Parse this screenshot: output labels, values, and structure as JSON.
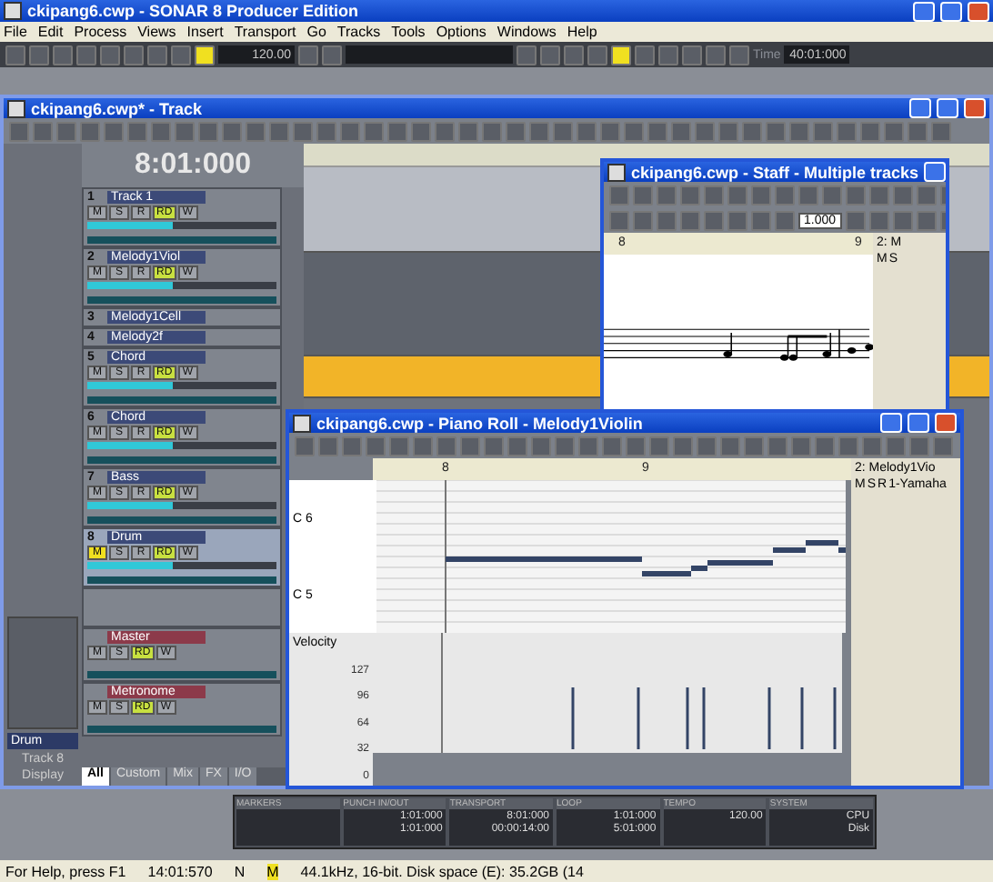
{
  "app": {
    "title": "ckipang6.cwp - SONAR 8 Producer Edition",
    "menu": [
      "File",
      "Edit",
      "Process",
      "Views",
      "Insert",
      "Transport",
      "Go",
      "Tracks",
      "Tools",
      "Options",
      "Windows",
      "Help"
    ],
    "toolbar": {
      "tempo": "120.00",
      "time_label": "Time",
      "time": "40:01:000"
    }
  },
  "track_view": {
    "title": "ckipang6.cwp* - Track",
    "now_time": "8:01:000",
    "inspector": {
      "track_name": "Drum",
      "track_number": "Track 8",
      "display": "Display"
    },
    "tracks": [
      {
        "number": "1",
        "name": "Track 1",
        "kind": "full",
        "selected": false,
        "buttons": [
          {
            "label": "M",
            "on": false
          },
          {
            "label": "S",
            "on": false
          },
          {
            "label": "R",
            "on": false
          },
          {
            "label": "RD",
            "on": true
          },
          {
            "label": "W",
            "on": false
          }
        ]
      },
      {
        "number": "2",
        "name": "Melody1Viol",
        "kind": "full",
        "selected": false,
        "buttons": [
          {
            "label": "M",
            "on": false
          },
          {
            "label": "S",
            "on": false
          },
          {
            "label": "R",
            "on": false
          },
          {
            "label": "RD",
            "on": true
          },
          {
            "label": "W",
            "on": false
          }
        ]
      },
      {
        "number": "3",
        "name": "Melody1Cell",
        "kind": "compact",
        "selected": false
      },
      {
        "number": "4",
        "name": "Melody2f",
        "kind": "compact",
        "selected": false
      },
      {
        "number": "5",
        "name": "Chord",
        "kind": "full",
        "selected": false,
        "buttons": [
          {
            "label": "M",
            "on": false
          },
          {
            "label": "S",
            "on": false
          },
          {
            "label": "R",
            "on": false
          },
          {
            "label": "RD",
            "on": true
          },
          {
            "label": "W",
            "on": false
          }
        ]
      },
      {
        "number": "6",
        "name": "Chord",
        "kind": "full",
        "selected": false,
        "buttons": [
          {
            "label": "M",
            "on": false
          },
          {
            "label": "S",
            "on": false
          },
          {
            "label": "R",
            "on": false
          },
          {
            "label": "RD",
            "on": true
          },
          {
            "label": "W",
            "on": false
          }
        ]
      },
      {
        "number": "7",
        "name": "Bass",
        "kind": "full",
        "selected": false,
        "buttons": [
          {
            "label": "M",
            "on": false
          },
          {
            "label": "S",
            "on": false
          },
          {
            "label": "R",
            "on": false
          },
          {
            "label": "RD",
            "on": true
          },
          {
            "label": "W",
            "on": false
          }
        ]
      },
      {
        "number": "8",
        "name": "Drum",
        "kind": "full",
        "selected": true,
        "buttons": [
          {
            "label": "M",
            "on": true
          },
          {
            "label": "S",
            "on": false
          },
          {
            "label": "R",
            "on": false
          },
          {
            "label": "RD",
            "on": true
          },
          {
            "label": "W",
            "on": false
          }
        ]
      }
    ],
    "buses": [
      {
        "name": "Master",
        "buttons": [
          {
            "label": "M",
            "on": false
          },
          {
            "label": "S",
            "on": false
          },
          {
            "label": "RD",
            "on": true
          },
          {
            "label": "W",
            "on": false
          }
        ]
      },
      {
        "name": "Metronome",
        "buttons": [
          {
            "label": "M",
            "on": false
          },
          {
            "label": "S",
            "on": false
          },
          {
            "label": "RD",
            "on": true
          },
          {
            "label": "W",
            "on": false
          }
        ]
      }
    ],
    "tabs": [
      {
        "label": "All",
        "selected": true
      },
      {
        "label": "Custom",
        "selected": false
      },
      {
        "label": "Mix",
        "selected": false
      },
      {
        "label": "FX",
        "selected": false
      },
      {
        "label": "I/O",
        "selected": false
      }
    ]
  },
  "staff": {
    "title": "ckipang6.cwp - Staff - Multiple tracks",
    "field": "1.000",
    "ruler": [
      "8",
      "9"
    ],
    "side_track": "2: M",
    "side_buttons": [
      "M",
      "S"
    ]
  },
  "piano_roll": {
    "title": "ckipang6.cwp - Piano Roll - Melody1Violin",
    "ruler": [
      "8",
      "9"
    ],
    "keys": [
      "C 6",
      "C 5"
    ],
    "velocity_label": "Velocity",
    "velocity_ticks": [
      "127",
      "96",
      "64",
      "32",
      "0"
    ],
    "track": {
      "name": "2: Melody1Vio",
      "buttons": [
        "M",
        "S",
        "R"
      ],
      "output": "1-Yamaha"
    }
  },
  "control_bar": [
    {
      "title": "MARKERS"
    },
    {
      "title": "PUNCH IN/OUT",
      "values": [
        "1:01:000",
        "1:01:000"
      ]
    },
    {
      "title": "TRANSPORT",
      "values": [
        "8:01:000",
        "00:00:14:00"
      ]
    },
    {
      "title": "LOOP",
      "values": [
        "1:01:000",
        "5:01:000"
      ]
    },
    {
      "title": "TEMPO",
      "values": [
        "120.00"
      ]
    },
    {
      "title": "SYSTEM",
      "values": [
        "CPU",
        "Disk"
      ]
    }
  ],
  "status_bar": [
    "For Help, press F1",
    "14:01:570",
    "N",
    "M",
    "44.1kHz, 16-bit. Disk space (E): 35.2GB (14"
  ]
}
